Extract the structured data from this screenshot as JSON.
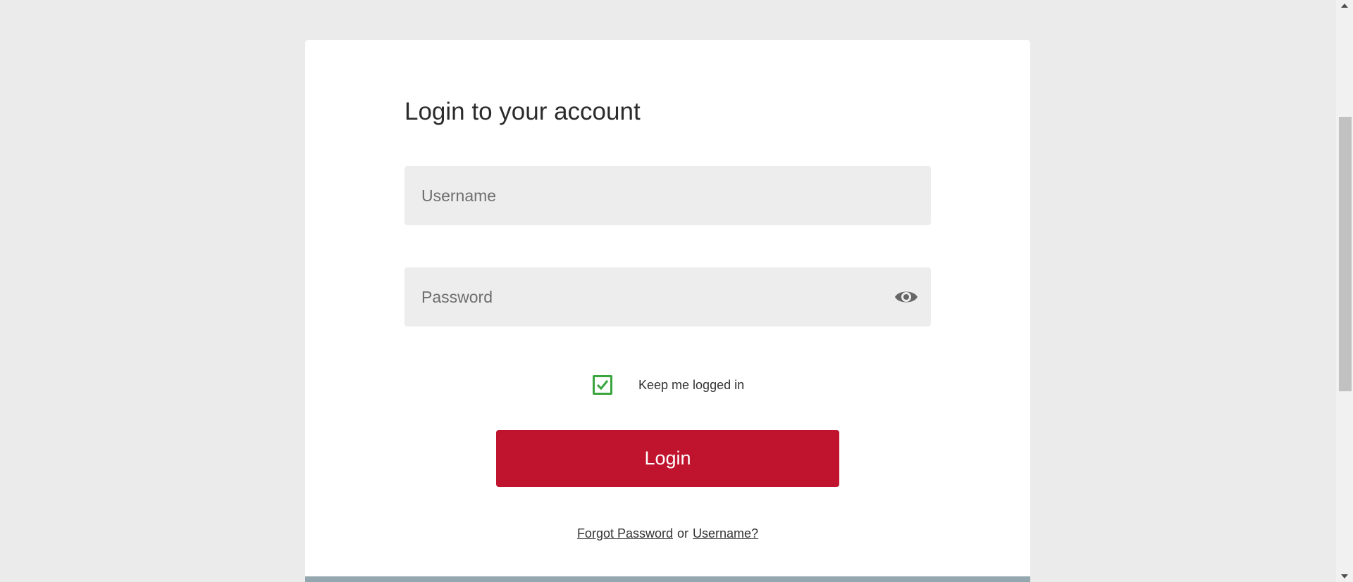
{
  "login": {
    "title": "Login to your account",
    "username_placeholder": "Username",
    "password_placeholder": "Password",
    "remember_label": "Keep me logged in",
    "remember_checked": true,
    "button_label": "Login",
    "forgot_password": "Forgot Password",
    "or_text": "or",
    "forgot_username": "Username?"
  },
  "icons": {
    "eye": "eye-icon",
    "check": "checkmark-icon"
  },
  "colors": {
    "accent": "#c0132e",
    "checkbox": "#3aa53e",
    "background": "#ebebeb",
    "field": "#ededee"
  }
}
